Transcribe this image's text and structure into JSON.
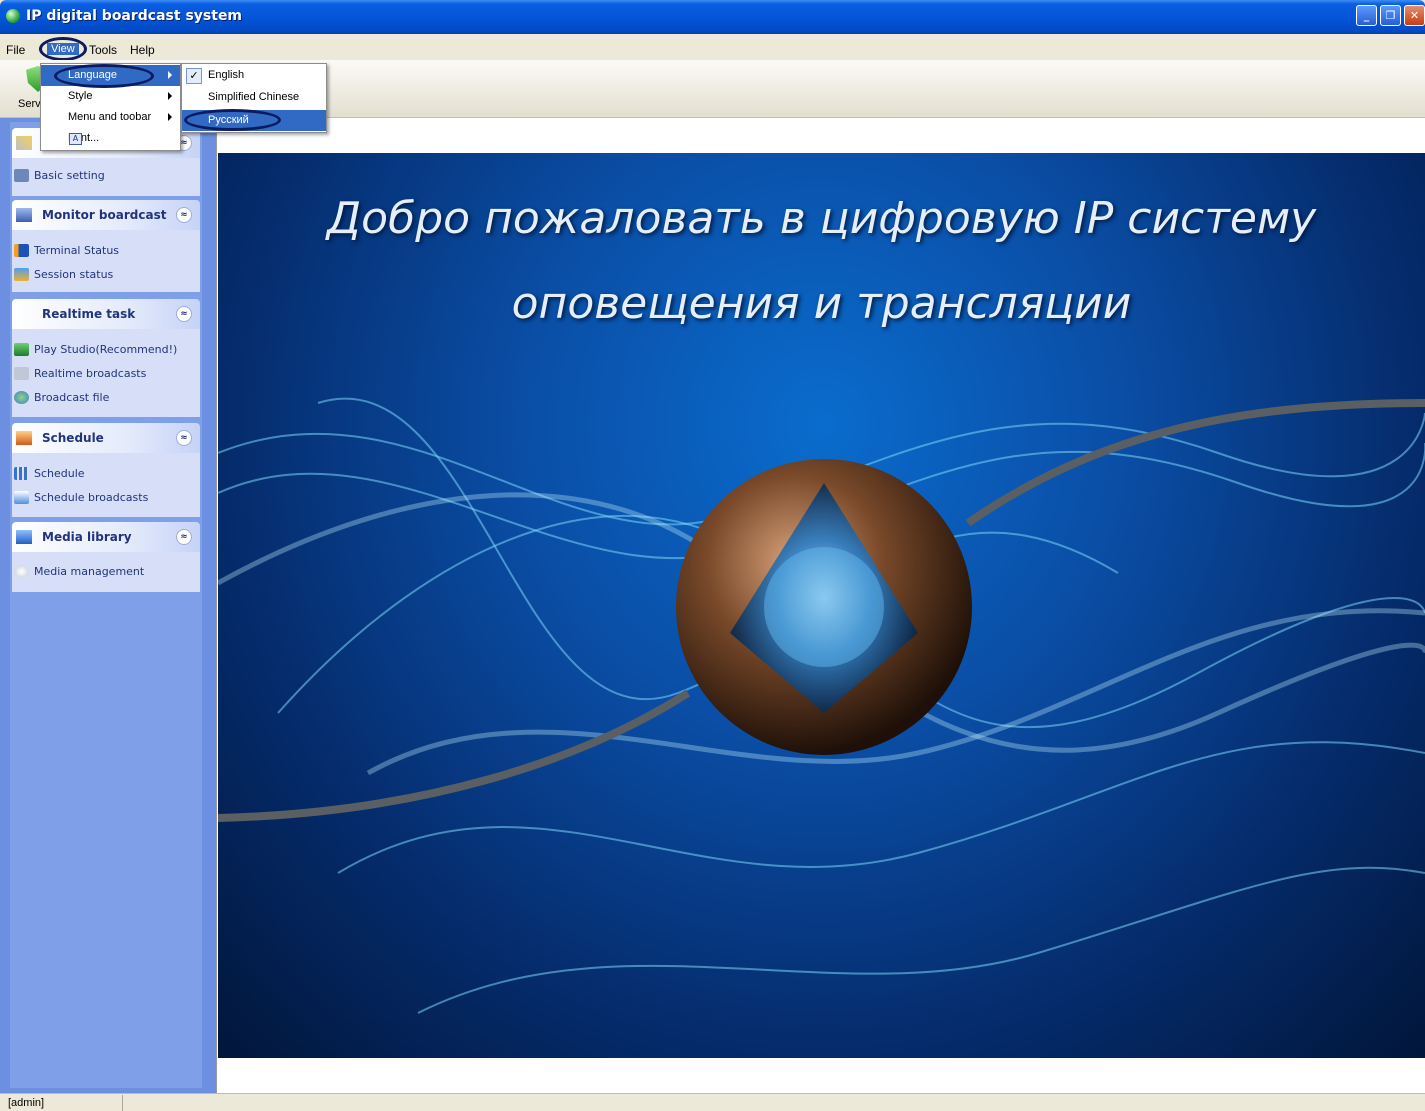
{
  "window": {
    "title": "IP digital boardcast system",
    "controls": {
      "minimize": "_",
      "maximize": "❐",
      "close": "✕"
    }
  },
  "menubar": {
    "file": "File",
    "view": "View",
    "tools": "Tools",
    "help": "Help"
  },
  "toolbar": {
    "label": "Serv"
  },
  "view_menu": {
    "items": [
      {
        "label": "Language",
        "has_submenu": true,
        "highlighted": true
      },
      {
        "label": "Style",
        "has_submenu": true
      },
      {
        "label": "Menu and toobar",
        "has_submenu": true
      },
      {
        "label": "Font...",
        "has_submenu": false
      }
    ]
  },
  "language_submenu": {
    "items": [
      {
        "label": "English",
        "checked": true
      },
      {
        "label": "Simplified Chinese",
        "checked": false
      },
      {
        "label": "Русский",
        "checked": false,
        "highlighted": true
      }
    ],
    "check_glyph": "✓"
  },
  "sidebar": {
    "first_panel": {
      "items": [
        {
          "label": "Basic setting",
          "icon": "settings-icon"
        }
      ]
    },
    "panels": [
      {
        "title": "Monitor boardcast",
        "icon": "monitor-icon",
        "items": [
          {
            "label": "Terminal Status",
            "icon": "terminal-icon"
          },
          {
            "label": "Session status",
            "icon": "session-icon"
          }
        ]
      },
      {
        "title": "Realtime task",
        "icon": "",
        "items": [
          {
            "label": "Play Studio(Recommend!)",
            "icon": "studio-icon"
          },
          {
            "label": "Realtime broadcasts",
            "icon": "speaker-icon"
          },
          {
            "label": "Broadcast file",
            "icon": "file-broadcast-icon"
          }
        ]
      },
      {
        "title": "Schedule",
        "icon": "schedule-icon",
        "items": [
          {
            "label": "Schedule",
            "icon": "calendar-icon"
          },
          {
            "label": "Schedule broadcasts",
            "icon": "schedule-broadcast-icon"
          }
        ]
      },
      {
        "title": "Media library",
        "icon": "media-icon",
        "items": [
          {
            "label": "Media management",
            "icon": "media-management-icon"
          }
        ]
      }
    ],
    "collapse_glyph": "≈"
  },
  "main": {
    "welcome_line1": "Добро пожаловать в цифровую IP систему",
    "welcome_line2": "оповещения и трансляции"
  },
  "statusbar": {
    "user": "[admin]"
  },
  "colors": {
    "title_bar": "#0454d8",
    "menu_highlight": "#316ac5",
    "sidebar_bg": "#6c8fe2",
    "panel_text": "#21347d",
    "annotation_circle": "#0b1b5e"
  }
}
